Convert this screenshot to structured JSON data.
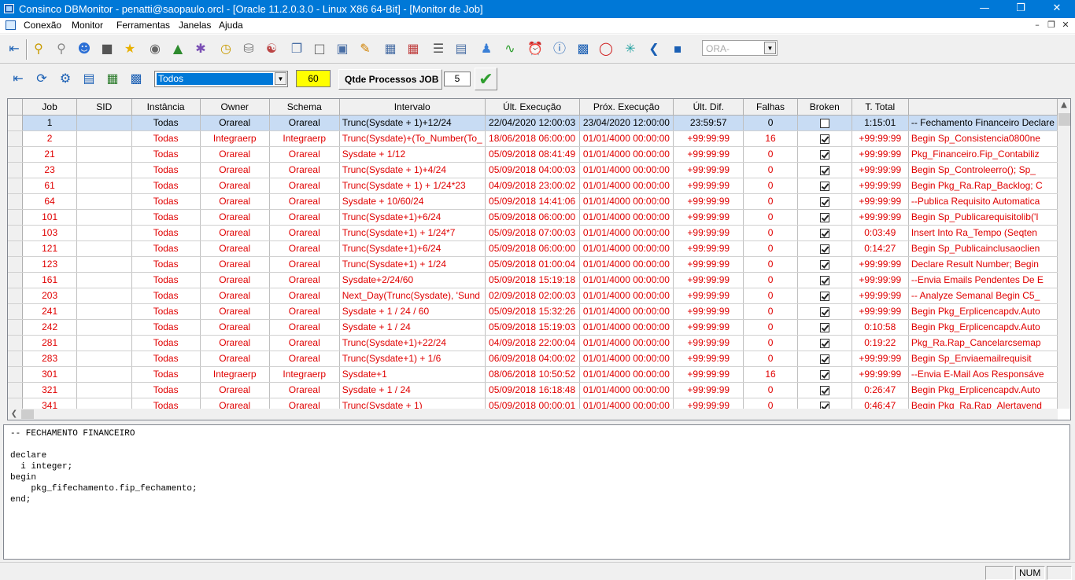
{
  "window": {
    "title": "Consinco DBMonitor - penatti@saopaulo.orcl - [Oracle 11.2.0.3.0 - Linux X86 64-Bit] - [Monitor de Job]"
  },
  "menu": [
    "Conexão",
    "Monitor",
    "Ferramentas",
    "Janelas",
    "Ajuda"
  ],
  "toolbar": {
    "ora_placeholder": "ORA-"
  },
  "filter": {
    "value": "Todos",
    "interval": "60",
    "qtde_label": "Qtde Processos JOB",
    "qtde_value": "5"
  },
  "grid": {
    "columns": [
      "Job",
      "SID",
      "Instância",
      "Owner",
      "Schema",
      "Intervalo",
      "Últ. Execução",
      "Próx. Execução",
      "Últ. Dif.",
      "Falhas",
      "Broken",
      "T. Total",
      ""
    ],
    "rows": [
      {
        "job": "1",
        "sid": "",
        "instancia": "Todas",
        "owner": "Orareal",
        "schema": "Orareal",
        "intervalo": "Trunc(Sysdate + 1)+12/24",
        "ult_exec": "22/04/2020 12:00:03",
        "prox_exec": "23/04/2020 12:00:00",
        "ult_dif": "23:59:57",
        "falhas": "0",
        "broken": false,
        "total": "1:15:01",
        "what": "-- Fechamento Financeiro  Declare"
      },
      {
        "job": "2",
        "sid": "",
        "instancia": "Todas",
        "owner": "Integraerp",
        "schema": "Integraerp",
        "intervalo": "Trunc(Sysdate)+(To_Number(To_",
        "ult_exec": "18/06/2018 06:00:00",
        "prox_exec": "01/01/4000 00:00:00",
        "ult_dif": "+99:99:99",
        "falhas": "16",
        "broken": true,
        "total": "+99:99:99",
        "what": "Begin Sp_Consistencia0800ne"
      },
      {
        "job": "21",
        "sid": "",
        "instancia": "Todas",
        "owner": "Orareal",
        "schema": "Orareal",
        "intervalo": "Sysdate + 1/12",
        "ult_exec": "05/09/2018 08:41:49",
        "prox_exec": "01/01/4000 00:00:00",
        "ult_dif": "+99:99:99",
        "falhas": "0",
        "broken": true,
        "total": "+99:99:99",
        "what": "Pkg_Financeiro.Fip_Contabiliz"
      },
      {
        "job": "23",
        "sid": "",
        "instancia": "Todas",
        "owner": "Orareal",
        "schema": "Orareal",
        "intervalo": "Trunc(Sysdate + 1)+4/24",
        "ult_exec": "05/09/2018 04:00:03",
        "prox_exec": "01/01/4000 00:00:00",
        "ult_dif": "+99:99:99",
        "falhas": "0",
        "broken": true,
        "total": "+99:99:99",
        "what": "Begin  Sp_Controleerro();  Sp_"
      },
      {
        "job": "61",
        "sid": "",
        "instancia": "Todas",
        "owner": "Orareal",
        "schema": "Orareal",
        "intervalo": "Trunc(Sysdate + 1) + 1/24*23",
        "ult_exec": "04/09/2018 23:00:02",
        "prox_exec": "01/01/4000 00:00:00",
        "ult_dif": "+99:99:99",
        "falhas": "0",
        "broken": true,
        "total": "+99:99:99",
        "what": "Begin Pkg_Ra.Rap_Backlog; C"
      },
      {
        "job": "64",
        "sid": "",
        "instancia": "Todas",
        "owner": "Orareal",
        "schema": "Orareal",
        "intervalo": "Sysdate + 10/60/24",
        "ult_exec": "05/09/2018 14:41:06",
        "prox_exec": "01/01/4000 00:00:00",
        "ult_dif": "+99:99:99",
        "falhas": "0",
        "broken": true,
        "total": "+99:99:99",
        "what": "--Publica Requisito Automatica"
      },
      {
        "job": "101",
        "sid": "",
        "instancia": "Todas",
        "owner": "Orareal",
        "schema": "Orareal",
        "intervalo": "Trunc(Sysdate+1)+6/24",
        "ult_exec": "05/09/2018 06:00:00",
        "prox_exec": "01/01/4000 00:00:00",
        "ult_dif": "+99:99:99",
        "falhas": "0",
        "broken": true,
        "total": "+99:99:99",
        "what": "Begin Sp_Publicarequisitolib('I"
      },
      {
        "job": "103",
        "sid": "",
        "instancia": "Todas",
        "owner": "Orareal",
        "schema": "Orareal",
        "intervalo": "Trunc(Sysdate+1) + 1/24*7",
        "ult_exec": "05/09/2018 07:00:03",
        "prox_exec": "01/01/4000 00:00:00",
        "ult_dif": "+99:99:99",
        "falhas": "0",
        "broken": true,
        "total": "0:03:49",
        "what": "Insert Into Ra_Tempo   (Seqten"
      },
      {
        "job": "121",
        "sid": "",
        "instancia": "Todas",
        "owner": "Orareal",
        "schema": "Orareal",
        "intervalo": "Trunc(Sysdate+1)+6/24",
        "ult_exec": "05/09/2018 06:00:00",
        "prox_exec": "01/01/4000 00:00:00",
        "ult_dif": "+99:99:99",
        "falhas": "0",
        "broken": true,
        "total": "0:14:27",
        "what": "Begin Sp_Publicainclusaoclien"
      },
      {
        "job": "123",
        "sid": "",
        "instancia": "Todas",
        "owner": "Orareal",
        "schema": "Orareal",
        "intervalo": "Trunc(Sysdate+1) + 1/24",
        "ult_exec": "05/09/2018 01:00:04",
        "prox_exec": "01/01/4000 00:00:00",
        "ult_dif": "+99:99:99",
        "falhas": "0",
        "broken": true,
        "total": "+99:99:99",
        "what": "Declare Result Number; Begin"
      },
      {
        "job": "161",
        "sid": "",
        "instancia": "Todas",
        "owner": "Orareal",
        "schema": "Orareal",
        "intervalo": "Sysdate+2/24/60",
        "ult_exec": "05/09/2018 15:19:18",
        "prox_exec": "01/01/4000 00:00:00",
        "ult_dif": "+99:99:99",
        "falhas": "0",
        "broken": true,
        "total": "+99:99:99",
        "what": "--Envia Emails Pendentes De E"
      },
      {
        "job": "203",
        "sid": "",
        "instancia": "Todas",
        "owner": "Orareal",
        "schema": "Orareal",
        "intervalo": "Next_Day(Trunc(Sysdate), 'Sund",
        "ult_exec": "02/09/2018 02:00:03",
        "prox_exec": "01/01/4000 00:00:00",
        "ult_dif": "+99:99:99",
        "falhas": "0",
        "broken": true,
        "total": "+99:99:99",
        "what": "-- Analyze Semanal Begin   C5_"
      },
      {
        "job": "241",
        "sid": "",
        "instancia": "Todas",
        "owner": "Orareal",
        "schema": "Orareal",
        "intervalo": "Sysdate + 1 / 24 / 60",
        "ult_exec": "05/09/2018 15:32:26",
        "prox_exec": "01/01/4000 00:00:00",
        "ult_dif": "+99:99:99",
        "falhas": "0",
        "broken": true,
        "total": "+99:99:99",
        "what": "Begin   Pkg_Erplicencapdv.Auto"
      },
      {
        "job": "242",
        "sid": "",
        "instancia": "Todas",
        "owner": "Orareal",
        "schema": "Orareal",
        "intervalo": "Sysdate + 1 / 24",
        "ult_exec": "05/09/2018 15:19:03",
        "prox_exec": "01/01/4000 00:00:00",
        "ult_dif": "+99:99:99",
        "falhas": "0",
        "broken": true,
        "total": "0:10:58",
        "what": "Begin   Pkg_Erplicencapdv.Auto"
      },
      {
        "job": "281",
        "sid": "",
        "instancia": "Todas",
        "owner": "Orareal",
        "schema": "Orareal",
        "intervalo": "Trunc(Sysdate+1)+22/24",
        "ult_exec": "04/09/2018 22:00:04",
        "prox_exec": "01/01/4000 00:00:00",
        "ult_dif": "+99:99:99",
        "falhas": "0",
        "broken": true,
        "total": "0:19:22",
        "what": "Pkg_Ra.Rap_Cancelarcsemap"
      },
      {
        "job": "283",
        "sid": "",
        "instancia": "Todas",
        "owner": "Orareal",
        "schema": "Orareal",
        "intervalo": "Trunc(Sysdate+1) + 1/6",
        "ult_exec": "06/09/2018 04:00:02",
        "prox_exec": "01/01/4000 00:00:00",
        "ult_dif": "+99:99:99",
        "falhas": "0",
        "broken": true,
        "total": "+99:99:99",
        "what": "Begin    Sp_Enviaemailrequisit"
      },
      {
        "job": "301",
        "sid": "",
        "instancia": "Todas",
        "owner": "Integraerp",
        "schema": "Integraerp",
        "intervalo": "Sysdate+1",
        "ult_exec": "08/06/2018 10:50:52",
        "prox_exec": "01/01/4000 00:00:00",
        "ult_dif": "+99:99:99",
        "falhas": "16",
        "broken": true,
        "total": "+99:99:99",
        "what": "--Envia E-Mail Aos Responsáve"
      },
      {
        "job": "321",
        "sid": "",
        "instancia": "Todas",
        "owner": "Orareal",
        "schema": "Orareal",
        "intervalo": "Sysdate + 1 / 24",
        "ult_exec": "05/09/2018 16:18:48",
        "prox_exec": "01/01/4000 00:00:00",
        "ult_dif": "+99:99:99",
        "falhas": "0",
        "broken": true,
        "total": "0:26:47",
        "what": "Begin   Pkg_Erplicencapdv.Auto"
      },
      {
        "job": "341",
        "sid": "",
        "instancia": "Todas",
        "owner": "Orareal",
        "schema": "Orareal",
        "intervalo": "Trunc(Sysdate + 1)",
        "ult_exec": "05/09/2018 00:00:01",
        "prox_exec": "01/01/4000 00:00:00",
        "ult_dif": "+99:99:99",
        "falhas": "0",
        "broken": true,
        "total": "0:46:47",
        "what": "Begin Pkg_Ra.Rap_Alertavend"
      }
    ]
  },
  "sql": "-- FECHAMENTO FINANCEIRO\n\ndeclare\n  i integer;\nbegin\n    pkg_fifechamento.fip_fechamento;\nend;",
  "status": {
    "num": "NUM"
  },
  "colors": {
    "title_bar": "#0078d7",
    "row_text": "#e00000",
    "selection": "#c8dcf4",
    "interval_box": "#ffff00"
  }
}
